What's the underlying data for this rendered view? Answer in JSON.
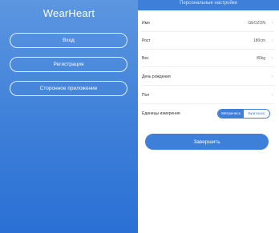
{
  "welcome": {
    "app_title": "WearHeart",
    "login_label": "Вход",
    "register_label": "Регистрация",
    "third_party_label": "Сторонное приложение"
  },
  "settings": {
    "header_title": "Персональные настройки",
    "fields": [
      {
        "label": "Имя",
        "value": "GEOZON"
      },
      {
        "label": "Рост",
        "value": "180cm"
      },
      {
        "label": "Вес",
        "value": "80kg"
      },
      {
        "label": "День рождения",
        "value": ""
      },
      {
        "label": "Пол",
        "value": ""
      }
    ],
    "units": {
      "label": "Единицы измерения",
      "options": [
        "Метрическ",
        "Британск"
      ],
      "selected": "Метрическ"
    },
    "finish_label": "Завершить"
  },
  "colors": {
    "accent": "#3d7fd9",
    "panel_gradient_top": "#5c96e0",
    "panel_gradient_bottom": "#2a70d4"
  },
  "icons": {
    "row_chevron": "chevron-right-icon"
  }
}
